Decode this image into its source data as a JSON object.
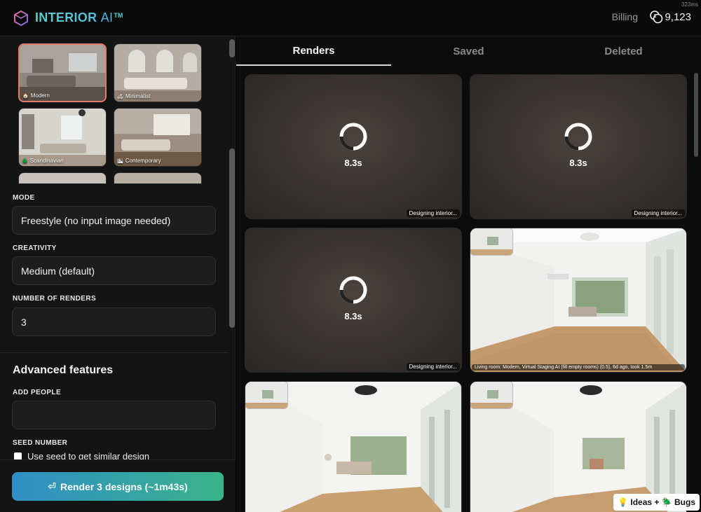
{
  "header": {
    "logo_main": "INTERIOR",
    "logo_ai": "AI",
    "logo_tm": "TM",
    "timing": "323ms",
    "billing": "Billing",
    "credits": "9,123"
  },
  "styles": [
    {
      "label": "Modern",
      "icon": "house-icon",
      "selected": true
    },
    {
      "label": "Minimalist",
      "icon": "sofa-icon",
      "selected": false
    },
    {
      "label": "Scandinavian",
      "icon": "tree-icon",
      "selected": false
    },
    {
      "label": "Contemporary",
      "icon": "building-icon",
      "selected": false
    }
  ],
  "form": {
    "mode_label": "MODE",
    "mode_value": "Freestyle (no input image needed)",
    "creativity_label": "CREATIVITY",
    "creativity_value": "Medium (default)",
    "renders_label": "NUMBER OF RENDERS",
    "renders_value": "3",
    "advanced_title": "Advanced features",
    "people_label": "ADD PEOPLE",
    "people_value": "",
    "seed_label": "SEED NUMBER",
    "seed_checkbox": "Use seed to get similar design",
    "render_button": "Render 3 designs (~1m43s)"
  },
  "tabs": [
    "Renders",
    "Saved",
    "Deleted"
  ],
  "cards": [
    {
      "type": "loading",
      "time": "8.3s",
      "status": "Designing interior..."
    },
    {
      "type": "loading",
      "time": "8.3s",
      "status": "Designing interior..."
    },
    {
      "type": "loading",
      "time": "8.3s",
      "status": "Designing interior..."
    },
    {
      "type": "image",
      "caption": "Living room: Modern, Virtual Staging AI (fill empty rooms) (0.5), 6d ago, took 1.5m"
    },
    {
      "type": "image",
      "caption": ""
    },
    {
      "type": "image",
      "caption": ""
    }
  ],
  "feedback": {
    "label": "Ideas + 🪲 Bugs",
    "icon": "lightbulb-icon"
  },
  "colors": {
    "accent_teal": "#5fd0c8",
    "button_start": "#2f8ec6",
    "button_end": "#39b48a",
    "selected_border": "#e07b6a"
  }
}
